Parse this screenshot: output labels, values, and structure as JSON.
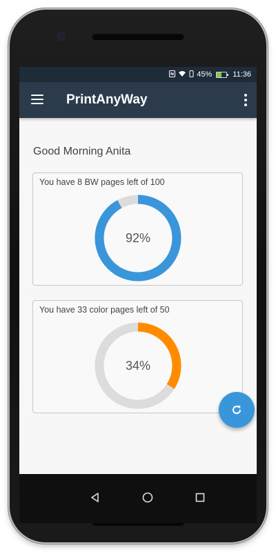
{
  "statusbar": {
    "battery_percent": "45%",
    "battery_level": 0.45,
    "time": "11:36",
    "icons": [
      "nfc-icon",
      "wifi-icon",
      "vibrate-icon",
      "battery-icon"
    ]
  },
  "appbar": {
    "title": "PrintAnyWay",
    "menu_icon": "hamburger-menu-icon",
    "overflow_icon": "more-vertical-icon"
  },
  "greeting": "Good Morning Anita",
  "cards": [
    {
      "label": "You have 8 BW pages left of 100",
      "percent_text": "92%",
      "fraction": 0.92,
      "color": "#3a96db"
    },
    {
      "label": "You have 33 color pages left of 50",
      "percent_text": "34%",
      "fraction": 0.34,
      "color": "#ff8c00"
    }
  ],
  "track_color": "#dcdcdc",
  "fab": {
    "icon": "refresh-icon",
    "color": "#3a96db"
  },
  "navbar": {
    "icons": [
      "back-icon",
      "home-icon",
      "recents-icon"
    ]
  }
}
